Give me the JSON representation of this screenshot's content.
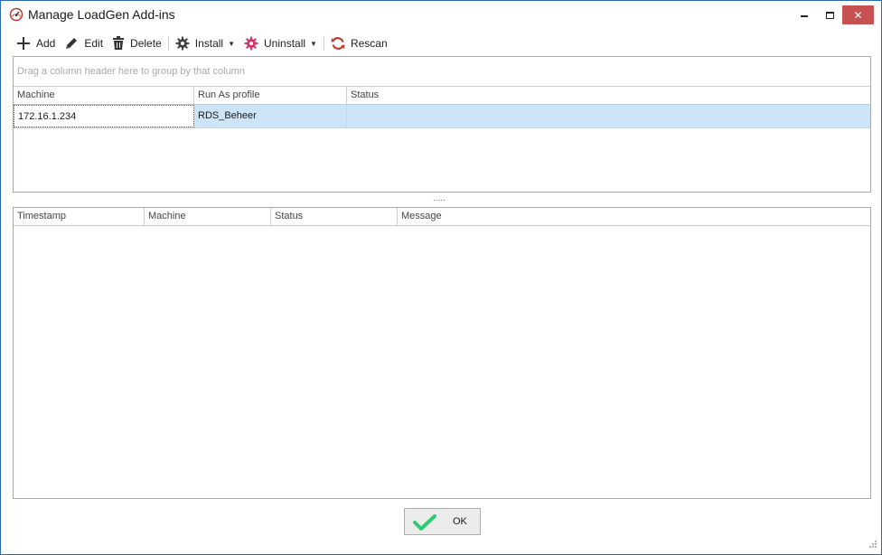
{
  "window": {
    "title": "Manage LoadGen Add-ins",
    "accent_color": "#c75050",
    "close_symbol": "✕"
  },
  "toolbar": {
    "items": [
      {
        "label": "Add",
        "icon": "plus-icon"
      },
      {
        "label": "Edit",
        "icon": "pencil-icon"
      },
      {
        "label": "Delete",
        "icon": "trash-icon"
      },
      {
        "label": "Install",
        "icon": "gear-icon",
        "dropdown": true
      },
      {
        "label": "Uninstall",
        "icon": "gear-pink-icon",
        "dropdown": true
      },
      {
        "label": "Rescan",
        "icon": "refresh-icon"
      }
    ]
  },
  "machines_grid": {
    "group_panel_hint": "Drag a column header here to group by that column",
    "columns": [
      "Machine",
      "Run As profile",
      "Status"
    ],
    "rows": [
      {
        "machine": "172.16.1.234",
        "run_as_profile": "RDS_Beheer",
        "status": ""
      }
    ],
    "selected_row_color": "#cce4f7"
  },
  "splitter": {
    "grip": "....."
  },
  "log_grid": {
    "columns": [
      "Timestamp",
      "Machine",
      "Status",
      "Message"
    ],
    "rows": []
  },
  "footer": {
    "ok_label": "OK",
    "ok_icon": "checkmark-icon"
  }
}
